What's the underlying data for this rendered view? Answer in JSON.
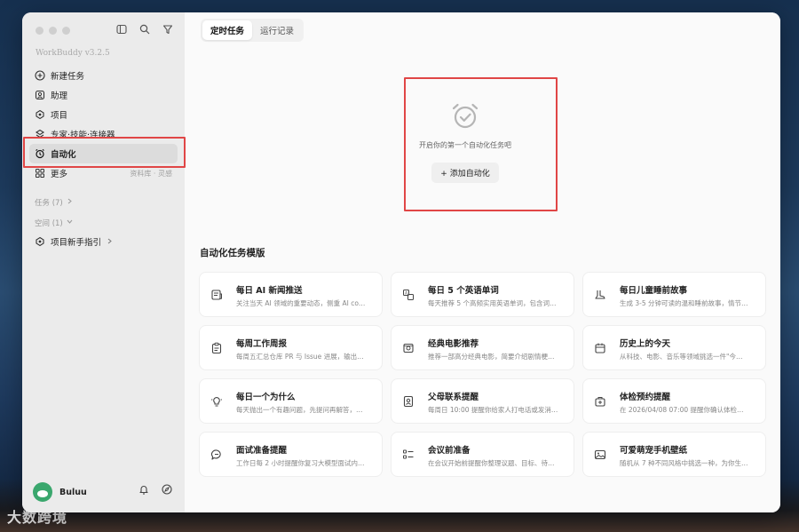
{
  "app": {
    "name": "WorkBuddy v3.2.5"
  },
  "sidebar": {
    "items": [
      {
        "label": "新建任务",
        "icon": "plus-circle-icon"
      },
      {
        "label": "助理",
        "icon": "assistant-icon"
      },
      {
        "label": "项目",
        "icon": "project-icon"
      },
      {
        "label": "专家·技能·连接器",
        "icon": "expert-icon"
      },
      {
        "label": "自动化",
        "icon": "alarm-icon"
      },
      {
        "label": "更多",
        "icon": "more-icon",
        "extra": "资料库 · 灵感"
      }
    ],
    "tasks_section": "任务 (7)",
    "space_section": "空间 (1)",
    "project_link": "项目新手指引"
  },
  "user": {
    "name": "Buluu"
  },
  "tabs": [
    "定时任务",
    "运行记录"
  ],
  "empty_state": {
    "text": "开启你的第一个自动化任务吧",
    "button": "+ 添加自动化"
  },
  "templates": {
    "title": "自动化任务模版",
    "cards": [
      {
        "title": "每日 AI 新闻推送",
        "desc": "关注当天 AI 领域的重要动态，侧重 AI co…",
        "icon": "news-icon"
      },
      {
        "title": "每日 5 个英语单词",
        "desc": "每天推荐 5 个高频实用英语单词，包含词…",
        "icon": "translate-icon"
      },
      {
        "title": "每日儿童睡前故事",
        "desc": "生成 3-5 分钟可读的温和睡前故事，情节…",
        "icon": "boot-icon"
      },
      {
        "title": "每周工作周报",
        "desc": "每周五汇总仓库 PR 与 Issue 进展，输出…",
        "icon": "clipboard-icon"
      },
      {
        "title": "经典电影推荐",
        "desc": "推荐一部高分经典电影，简要介绍剧情梗…",
        "icon": "film-icon"
      },
      {
        "title": "历史上的今天",
        "desc": "从科技、电影、音乐等领域挑选一件\"今…",
        "icon": "calendar-icon"
      },
      {
        "title": "每日一个为什么",
        "desc": "每天抛出一个有趣问题，先提问再解答，…",
        "icon": "bulb-icon"
      },
      {
        "title": "父母联系提醒",
        "desc": "每周日 10:00 提醒你给家人打电话或发消…",
        "icon": "contact-icon"
      },
      {
        "title": "体检预约提醒",
        "desc": "在 2026/04/08 07:00 提醒你确认体检…",
        "icon": "health-icon"
      },
      {
        "title": "面试准备提醒",
        "desc": "工作日每 2 小时提醒你复习大模型面试内…",
        "icon": "chat-icon"
      },
      {
        "title": "会议前准备",
        "desc": "在会议开始前提醒你整理议题、目标、待…",
        "icon": "checklist-icon"
      },
      {
        "title": "可爱萌宠手机壁纸",
        "desc": "随机从 7 种不同风格中挑选一种，为你生…",
        "icon": "image-icon"
      }
    ]
  },
  "watermark": "大数跨境",
  "colors": {
    "highlight": "#e04646",
    "avatar": "#3aa76d"
  }
}
